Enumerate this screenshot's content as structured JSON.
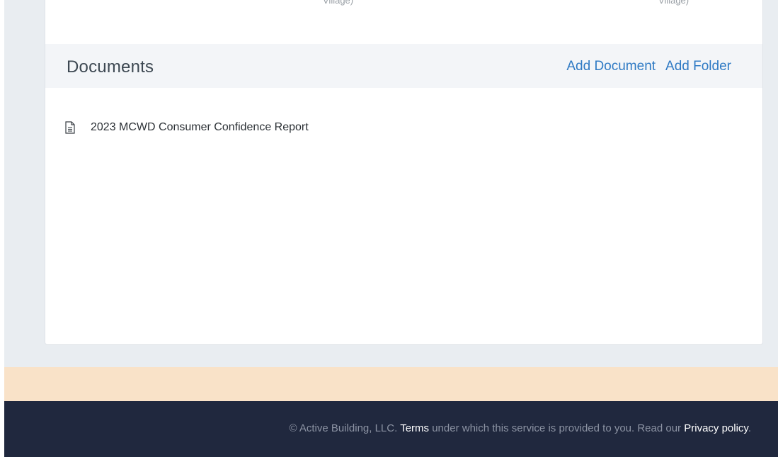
{
  "partial_row": {
    "left_text": "",
    "left_sub": "Village)",
    "right_text": "",
    "right_sub": "Village)"
  },
  "documents": {
    "title": "Documents",
    "add_document_label": "Add Document",
    "add_folder_label": "Add Folder",
    "items": [
      {
        "icon": "document-icon",
        "name": "2023 MCWD Consumer Confidence Report"
      }
    ]
  },
  "footer": {
    "copyright": "© Active Building, LLC.",
    "terms_link": "Terms",
    "middle_text": "under which this service is provided to you. Read our",
    "privacy_link": "Privacy policy",
    "end_text": "."
  },
  "colors": {
    "accent_link": "#2f7ac4",
    "footer_bg": "#20283e",
    "peach_band": "#f9e2c8"
  }
}
